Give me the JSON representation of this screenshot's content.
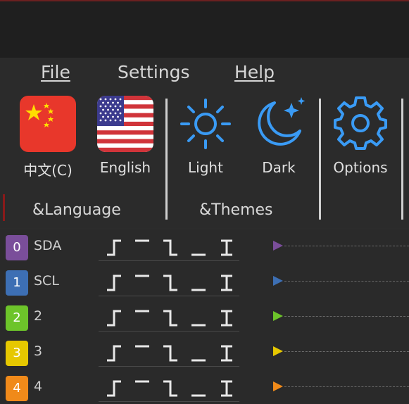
{
  "menu": {
    "file": "File",
    "settings": "Settings",
    "help": "Help"
  },
  "ribbon": {
    "language_group": "&Language",
    "themes_group": "&Themes",
    "tools": {
      "chinese": "中文(C)",
      "english": "English",
      "light": "Light",
      "dark": "Dark",
      "options": "Options"
    }
  },
  "colors": {
    "accent_icon": "#3a9bf5",
    "channel_0": "#7a4e9a",
    "channel_1": "#3d6fb4",
    "channel_2": "#6dc42a",
    "channel_3": "#e6c800",
    "channel_4": "#f08a1a"
  },
  "channels": [
    {
      "index": "0",
      "name": "SDA"
    },
    {
      "index": "1",
      "name": "SCL"
    },
    {
      "index": "2",
      "name": "2"
    },
    {
      "index": "3",
      "name": "3"
    },
    {
      "index": "4",
      "name": "4"
    }
  ],
  "trigger_icons": [
    "rising-edge-icon",
    "high-level-icon",
    "falling-edge-icon",
    "low-level-icon",
    "any-edge-icon"
  ]
}
